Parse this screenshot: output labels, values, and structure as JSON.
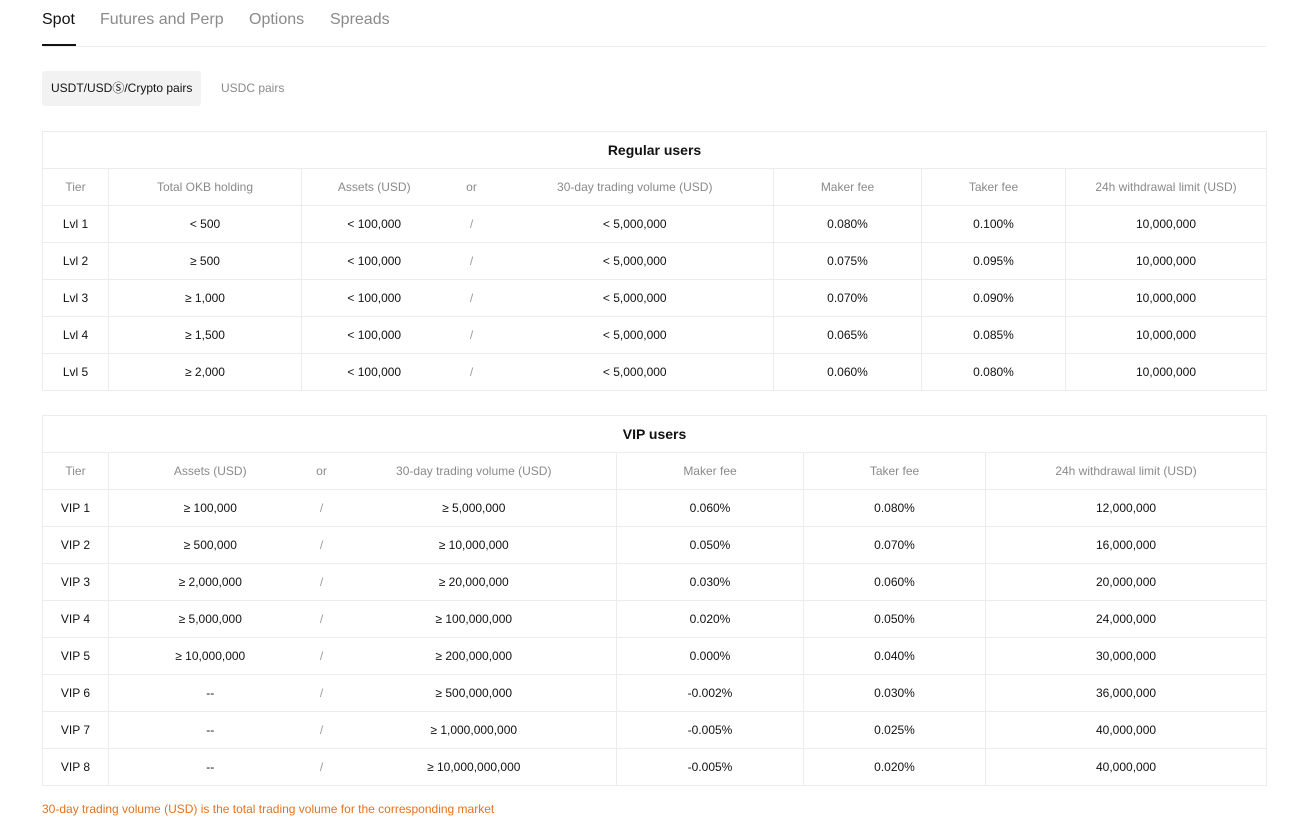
{
  "tabs": [
    "Spot",
    "Futures and Perp",
    "Options",
    "Spreads"
  ],
  "subtabs": [
    "USDT/USDⓈ/Crypto pairs",
    "USDC pairs"
  ],
  "regular": {
    "title": "Regular users",
    "headers": [
      "Tier",
      "Total OKB holding",
      "Assets (USD)",
      "or",
      "30-day trading volume (USD)",
      "Maker fee",
      "Taker fee",
      "24h withdrawal limit (USD)"
    ],
    "rows": [
      [
        "Lvl 1",
        "< 500",
        "< 100,000",
        "/",
        "< 5,000,000",
        "0.080%",
        "0.100%",
        "10,000,000"
      ],
      [
        "Lvl 2",
        "≥ 500",
        "< 100,000",
        "/",
        "< 5,000,000",
        "0.075%",
        "0.095%",
        "10,000,000"
      ],
      [
        "Lvl 3",
        "≥ 1,000",
        "< 100,000",
        "/",
        "< 5,000,000",
        "0.070%",
        "0.090%",
        "10,000,000"
      ],
      [
        "Lvl 4",
        "≥ 1,500",
        "< 100,000",
        "/",
        "< 5,000,000",
        "0.065%",
        "0.085%",
        "10,000,000"
      ],
      [
        "Lvl 5",
        "≥ 2,000",
        "< 100,000",
        "/",
        "< 5,000,000",
        "0.060%",
        "0.080%",
        "10,000,000"
      ]
    ]
  },
  "vip": {
    "title": "VIP users",
    "headers": [
      "Tier",
      "Assets (USD)",
      "or",
      "30-day trading volume (USD)",
      "Maker fee",
      "Taker fee",
      "24h withdrawal limit (USD)"
    ],
    "rows": [
      [
        "VIP 1",
        "≥ 100,000",
        "/",
        "≥ 5,000,000",
        "0.060%",
        "0.080%",
        "12,000,000"
      ],
      [
        "VIP 2",
        "≥ 500,000",
        "/",
        "≥ 10,000,000",
        "0.050%",
        "0.070%",
        "16,000,000"
      ],
      [
        "VIP 3",
        "≥ 2,000,000",
        "/",
        "≥ 20,000,000",
        "0.030%",
        "0.060%",
        "20,000,000"
      ],
      [
        "VIP 4",
        "≥ 5,000,000",
        "/",
        "≥ 100,000,000",
        "0.020%",
        "0.050%",
        "24,000,000"
      ],
      [
        "VIP 5",
        "≥ 10,000,000",
        "/",
        "≥ 200,000,000",
        "0.000%",
        "0.040%",
        "30,000,000"
      ],
      [
        "VIP 6",
        "--",
        "/",
        "≥ 500,000,000",
        "-0.002%",
        "0.030%",
        "36,000,000"
      ],
      [
        "VIP 7",
        "--",
        "/",
        "≥ 1,000,000,000",
        "-0.005%",
        "0.025%",
        "40,000,000"
      ],
      [
        "VIP 8",
        "--",
        "/",
        "≥ 10,000,000,000",
        "-0.005%",
        "0.020%",
        "40,000,000"
      ]
    ]
  },
  "note": "30-day trading volume (USD) is the total trading volume for the corresponding market"
}
